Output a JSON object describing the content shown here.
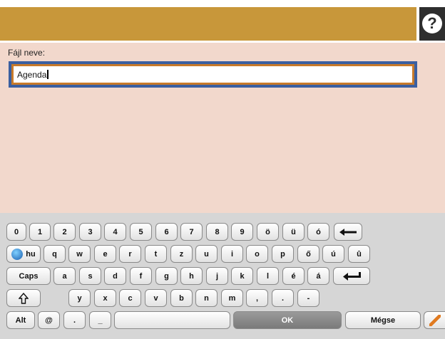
{
  "help": {
    "icon": "help-icon",
    "glyph": "?"
  },
  "form": {
    "label": "Fájl neve:",
    "value": "Agenda"
  },
  "keyboard": {
    "row1": [
      "0",
      "1",
      "2",
      "3",
      "4",
      "5",
      "6",
      "7",
      "8",
      "9",
      "ö",
      "ü",
      "ó"
    ],
    "backspace": "backspace-icon",
    "row2_lang": "hu",
    "row2": [
      "q",
      "w",
      "e",
      "r",
      "t",
      "z",
      "u",
      "i",
      "o",
      "p",
      "ő",
      "ú",
      "û"
    ],
    "caps": "Caps",
    "row3": [
      "a",
      "s",
      "d",
      "f",
      "g",
      "h",
      "j",
      "k",
      "l",
      "é",
      "á"
    ],
    "enter": "enter-icon",
    "shift": "shift-icon",
    "row4": [
      "y",
      "x",
      "c",
      "v",
      "b",
      "n",
      "m",
      ",",
      ".",
      "-"
    ],
    "alt": "Alt",
    "at": "@",
    "dot": ".",
    "underscore": "_",
    "ok": "OK",
    "cancel": "Mégse"
  }
}
